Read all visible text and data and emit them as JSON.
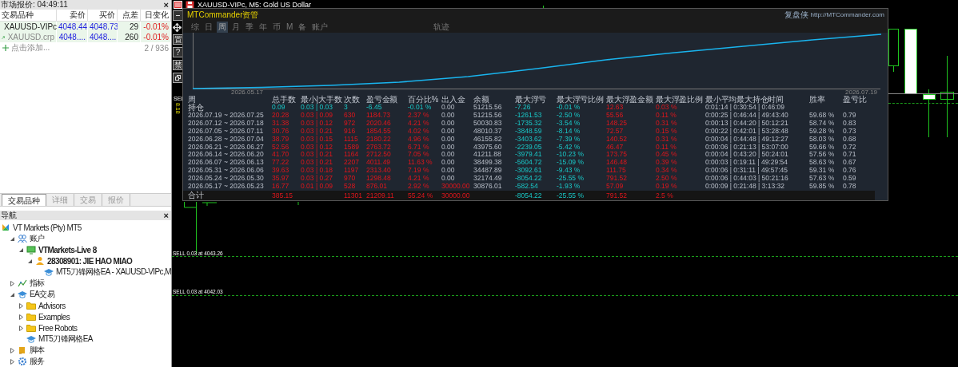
{
  "market_watch": {
    "title": "市场报价: 04:49:11",
    "close": "×",
    "columns": [
      "交易品种",
      "卖价",
      "买价",
      "点差",
      "日变化"
    ],
    "rows": [
      {
        "symbol": "XAUUSD-VIPc",
        "bid": "4048.44",
        "ask": "4048.73",
        "spread": "29",
        "change": "-0.01%",
        "dimmed": false
      },
      {
        "symbol": "XAUUSD.crp",
        "bid": "4048....",
        "ask": "4048....",
        "spread": "260",
        "change": "-0.01%",
        "dimmed": true
      }
    ],
    "add_label": "点击添加...",
    "count": "2 / 936"
  },
  "bottom_tabs": [
    {
      "label": "交易品种",
      "selected": true
    },
    {
      "label": "详细",
      "selected": false
    },
    {
      "label": "交易",
      "selected": false
    },
    {
      "label": "报价",
      "selected": false
    }
  ],
  "navigator": {
    "title": "导航",
    "close": "×",
    "tree": [
      {
        "label": "VT Markets (Pty) MT5",
        "kind": "broker",
        "children": [
          {
            "label": "账户",
            "kind": "accounts",
            "expanded": true,
            "children": [
              {
                "label": "VTMarkets-Live 8",
                "kind": "server",
                "bold": true,
                "expanded": true,
                "children": [
                  {
                    "label": "28308901: JIE HAO MIAO",
                    "kind": "user",
                    "bold": true,
                    "expanded": true,
                    "children": [
                      {
                        "label": "MT5刀锋网格EA - XAUUSD-VIPc,M",
                        "kind": "ea",
                        "bold": false
                      }
                    ]
                  }
                ]
              }
            ]
          },
          {
            "label": "指标",
            "kind": "indicators",
            "expanded": false
          },
          {
            "label": "EA交易",
            "kind": "ea",
            "expanded": true,
            "children": [
              {
                "label": "Advisors",
                "kind": "folder",
                "expanded": false
              },
              {
                "label": "Examples",
                "kind": "folder",
                "expanded": false
              },
              {
                "label": "Free Robots",
                "kind": "folder",
                "expanded": false
              },
              {
                "label": "MT5刀锋网格EA",
                "kind": "ea"
              }
            ]
          },
          {
            "label": "脚本",
            "kind": "scripts",
            "expanded": false
          },
          {
            "label": "服务",
            "kind": "services",
            "expanded": false
          }
        ]
      }
    ]
  },
  "chart": {
    "title": "XAUUSD-VIPc, M5:  Gold US Dollar",
    "toolbar": [
      {
        "kind": "minus"
      },
      {
        "kind": "move"
      },
      {
        "kind": "char",
        "text": "置"
      },
      {
        "kind": "char",
        "text": "?"
      },
      {
        "kind": "char",
        "text": "禁"
      },
      {
        "kind": "window"
      }
    ],
    "side_labels": [
      "SEL",
      "8.18"
    ],
    "order_labels": [
      "SELL 0.03 at 4043.26",
      "SELL 0.03 at 4042.03"
    ]
  },
  "panel": {
    "title": "MTCommander资管",
    "brand": "复盘侠",
    "url": "http://MTCommander.com",
    "tabs": [
      {
        "label": "综",
        "selected": false
      },
      {
        "label": "日",
        "selected": false
      },
      {
        "label": "周",
        "selected": true
      },
      {
        "label": "月",
        "selected": false
      },
      {
        "label": "季",
        "selected": false
      },
      {
        "label": "年",
        "selected": false
      },
      {
        "label": "币",
        "selected": false
      },
      {
        "label": "M",
        "selected": false
      },
      {
        "label": "备",
        "selected": false
      },
      {
        "label": "账户",
        "selected": false
      }
    ],
    "trace_tab": {
      "label": "轨迹",
      "selected": false
    },
    "curve": {
      "start_date": "2026.05.17",
      "end_date": "2026.07.19"
    },
    "columns": [
      "周",
      "总手数",
      "最小|大手数",
      "次数",
      "盈亏金额",
      "百分比%",
      "出入金",
      "余额",
      "最大浮亏",
      "最大浮亏比例",
      "最大浮盈金额",
      "最大浮盈比例",
      "最小平均最大持仓时间",
      "胜率",
      "盈亏比"
    ],
    "rows": [
      {
        "kind": "open",
        "deposit": false,
        "cells": [
          "持仓",
          "0.09",
          "0.03 | 0.03",
          "3",
          "-6.45",
          "-0.01 %",
          "0.00",
          "51215.56",
          "-7.26",
          "-0.01 %",
          "12.63",
          "0.03 %",
          "0:01:14 | 0:30:54 | 0:46:09",
          null,
          null
        ]
      },
      {
        "kind": "period",
        "deposit": false,
        "cells": [
          "2026.07.19 ~ 2026.07.25",
          "20.28",
          "0.03 | 0.09",
          "630",
          "1184.73",
          "2.37 %",
          "0.00",
          "51215.56",
          "-1261.53",
          "-2.50 %",
          "55.56",
          "0.11 %",
          "0:00:25 | 0:46:44 | 49:43:40",
          "59.68 %",
          "0.79"
        ]
      },
      {
        "kind": "period",
        "deposit": false,
        "cells": [
          "2026.07.12 ~ 2026.07.18",
          "31.38",
          "0.03 | 0.12",
          "972",
          "2020.46",
          "4.21 %",
          "0.00",
          "50030.83",
          "-1735.32",
          "-3.54 %",
          "148.25",
          "0.31 %",
          "0:00:13 | 0:44:20 | 50:12:21",
          "58.74 %",
          "0.83"
        ]
      },
      {
        "kind": "period",
        "deposit": false,
        "cells": [
          "2026.07.05 ~ 2026.07.11",
          "30.76",
          "0.03 | 0.21",
          "916",
          "1854.55",
          "4.02 %",
          "0.00",
          "48010.37",
          "-3848.59",
          "-8.14 %",
          "72.57",
          "0.15 %",
          "0:00:22 | 0:42:01 | 53:28:48",
          "59.28 %",
          "0.73"
        ]
      },
      {
        "kind": "period",
        "deposit": false,
        "cells": [
          "2026.06.28 ~ 2026.07.04",
          "38.79",
          "0.03 | 0.15",
          "1115",
          "2180.22",
          "4.96 %",
          "0.00",
          "46155.82",
          "-3403.62",
          "-7.39 %",
          "140.52",
          "0.31 %",
          "0:00:04 | 0:44:48 | 49:12:27",
          "58.03 %",
          "0.68"
        ]
      },
      {
        "kind": "period",
        "deposit": false,
        "cells": [
          "2026.06.21 ~ 2026.06.27",
          "52.56",
          "0.03 | 0.12",
          "1589",
          "2763.72",
          "6.71 %",
          "0.00",
          "43975.60",
          "-2239.05",
          "-5.42 %",
          "46.47",
          "0.11 %",
          "0:00:06 | 0:21:13 | 53:07:00",
          "59.66 %",
          "0.72"
        ]
      },
      {
        "kind": "period",
        "deposit": false,
        "cells": [
          "2026.06.14 ~ 2026.06.20",
          "41.70",
          "0.03 | 0.21",
          "1164",
          "2712.50",
          "7.05 %",
          "0.00",
          "41211.88",
          "-3979.41",
          "-10.23 %",
          "173.75",
          "0.45 %",
          "0:00:04 | 0:43:20 | 50:24:01",
          "57.56 %",
          "0.71"
        ]
      },
      {
        "kind": "period",
        "deposit": false,
        "cells": [
          "2026.06.07 ~ 2026.06.13",
          "77.22",
          "0.03 | 0.21",
          "2207",
          "4011.49",
          "11.63 %",
          "0.00",
          "38499.38",
          "-5604.72",
          "-15.09 %",
          "146.48",
          "0.39 %",
          "0:00:03 | 0:19:11 | 49:29:54",
          "58.63 %",
          "0.67"
        ]
      },
      {
        "kind": "period",
        "deposit": false,
        "cells": [
          "2026.05.31 ~ 2026.06.06",
          "39.63",
          "0.03 | 0.18",
          "1197",
          "2313.40",
          "7.19 %",
          "0.00",
          "34487.89",
          "-3092.61",
          "-9.43 %",
          "111.75",
          "0.34 %",
          "0:00:06 | 0:31:11 | 49:57:45",
          "59.31 %",
          "0.76"
        ]
      },
      {
        "kind": "period",
        "deposit": false,
        "cells": [
          "2026.05.24 ~ 2026.05.30",
          "35.97",
          "0.03 | 0.27",
          "970",
          "1298.48",
          "4.21 %",
          "0.00",
          "32174.49",
          "-8054.22",
          "-25.55 %",
          "791.52",
          "2.50 %",
          "0:00:06 | 0:44:03 | 50:21:16",
          "57.63 %",
          "0.59"
        ]
      },
      {
        "kind": "period",
        "deposit": true,
        "cells": [
          "2026.05.17 ~ 2026.05.23",
          "16.77",
          "0.01 | 0.09",
          "528",
          "876.01",
          "2.92 %",
          "30000.00",
          "30876.01",
          "-582.54",
          "-1.93 %",
          "57.09",
          "0.19 %",
          "0:00:09 | 0:21:48 | 3:13:32",
          "59.85 %",
          "0.78"
        ]
      },
      {
        "kind": "total",
        "deposit": true,
        "cells": [
          "合计",
          "385.15",
          null,
          "11301",
          "21209.11",
          "55.24 %",
          "30000.00",
          null,
          "-8054.22",
          "-25.55 %",
          "791.52",
          "2.5 %",
          null,
          null,
          null
        ]
      }
    ]
  }
}
